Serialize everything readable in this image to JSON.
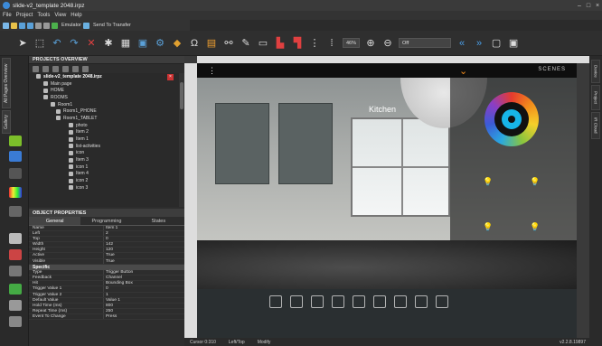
{
  "window": {
    "title": "slide-v2_template 2048.irpz"
  },
  "menu": [
    "File",
    "Project",
    "Tools",
    "View",
    "Help"
  ],
  "toolbar": {
    "emulator": "Emulator",
    "send": "Send To Transfer",
    "zoom": "46%",
    "off": "Off"
  },
  "left_tabs": {
    "pages": "All Pages Overview",
    "gallery": "Gallery",
    "android": "Android"
  },
  "overview": {
    "title": "PROJECTS OVERVIEW",
    "tree": [
      {
        "label": "slide-v2_template 2048.irpz",
        "indent": 0
      },
      {
        "label": "Main page",
        "indent": 1
      },
      {
        "label": "HOME",
        "indent": 1
      },
      {
        "label": "ROOMS",
        "indent": 1
      },
      {
        "label": "Room1",
        "indent": 2
      },
      {
        "label": "Room1_PHONE",
        "indent": 3
      },
      {
        "label": "Room1_TABLET",
        "indent": 3
      },
      {
        "label": "photo",
        "indent": 4
      },
      {
        "label": "Item 2",
        "indent": 4
      },
      {
        "label": "Item 1",
        "indent": 4
      },
      {
        "label": "list-activities",
        "indent": 4
      },
      {
        "label": "icon",
        "indent": 4
      },
      {
        "label": "Item 3",
        "indent": 4
      },
      {
        "label": "icon 1",
        "indent": 4
      },
      {
        "label": "Item 4",
        "indent": 4
      },
      {
        "label": "icon 2",
        "indent": 4
      },
      {
        "label": "icon 3",
        "indent": 4
      }
    ]
  },
  "properties": {
    "title": "OBJECT PROPERTIES",
    "tabs": [
      "General",
      "Programming",
      "States"
    ],
    "rows": [
      [
        "Name",
        "Item 1"
      ],
      [
        "Left",
        "2"
      ],
      [
        "Top",
        "0"
      ],
      [
        "Width",
        "142"
      ],
      [
        "Height",
        "120"
      ],
      [
        "Active",
        "True"
      ],
      [
        "Visible",
        "True"
      ]
    ],
    "section": "Specific",
    "rows2": [
      [
        "Type",
        "Trigger Button"
      ],
      [
        "Feedback",
        "Channel"
      ],
      [
        "Hit",
        "Bounding Box"
      ],
      [
        "Trigger Value 1",
        "0"
      ],
      [
        "Trigger Value 2",
        "1"
      ],
      [
        "Default Value",
        "Value 1"
      ],
      [
        "Hold Time (ms)",
        "800"
      ],
      [
        "Repeat Time (ms)",
        "250"
      ],
      [
        "Event To Change",
        "Press"
      ]
    ]
  },
  "screen": {
    "room": "Kitchen",
    "brand": "SCENES"
  },
  "status": {
    "cursor": "Cursor 0:310",
    "anchor": "Left/Top",
    "mode": "Modify",
    "version": "v2.2.8.19897"
  },
  "right_tabs": [
    "Device",
    "Project",
    "IR Cloud"
  ]
}
